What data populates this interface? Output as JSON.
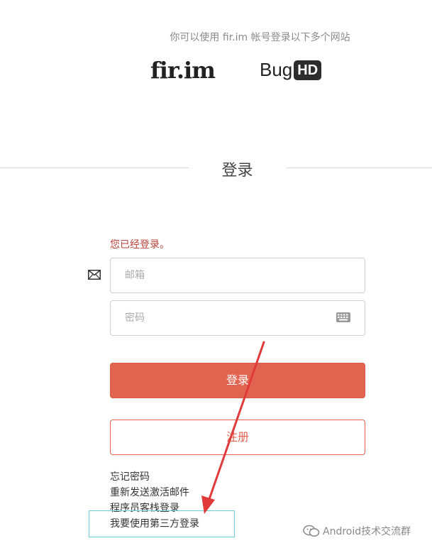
{
  "header": {
    "subtitle": "你可以使用 fir.im 帐号登录以下多个网站",
    "brands": {
      "firim": "fir.im",
      "bug_prefix": "Bug",
      "bug_suffix": "HD"
    }
  },
  "login": {
    "title": "登录",
    "status_message": "您已经登录。",
    "email_placeholder": "邮箱",
    "password_placeholder": "密码",
    "login_button": "登录",
    "register_button": "注册"
  },
  "links": {
    "forgot_password": "忘记密码",
    "resend_activation": "重新发送激活邮件",
    "coder_login": "程序员客栈登录",
    "third_party_login": "我要使用第三方登录"
  },
  "watermark": {
    "text": "Android技术交流群"
  },
  "colors": {
    "accent": "#e06450",
    "status": "#b8413a",
    "annotation_arrow": "#e03a3a",
    "highlight_box": "#6fd0d8"
  },
  "icons": {
    "email_field": "envelope-icon",
    "password_field": "keyboard-icon",
    "watermark": "wechat-icon"
  }
}
